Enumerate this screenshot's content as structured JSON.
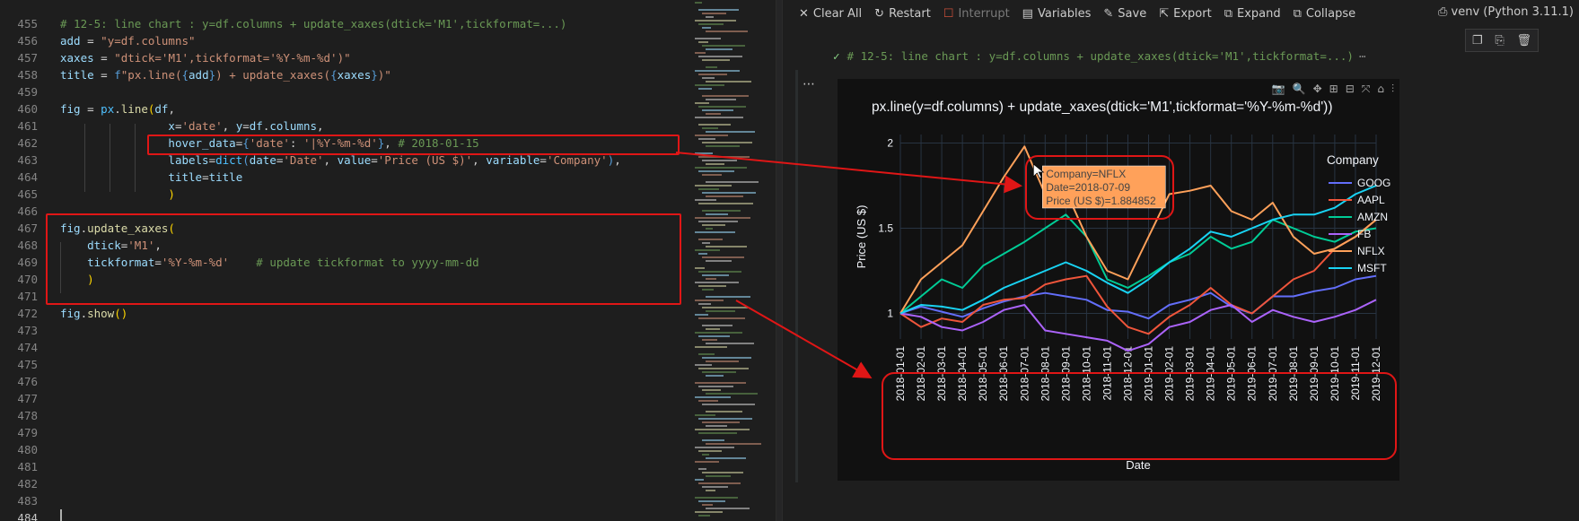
{
  "editor": {
    "line_numbers": [
      "455",
      "456",
      "457",
      "458",
      "459",
      "460",
      "461",
      "462",
      "463",
      "464",
      "465",
      "466",
      "467",
      "468",
      "469",
      "470",
      "471",
      "472",
      "473",
      "474",
      "475",
      "476",
      "477",
      "478",
      "479",
      "480",
      "481",
      "482",
      "483",
      "484"
    ]
  },
  "notebook": {
    "toolbar": {
      "clear_all": "Clear All",
      "restart": "Restart",
      "interrupt": "Interrupt",
      "variables": "Variables",
      "save": "Save",
      "export": "Export",
      "expand": "Expand",
      "collapse": "Collapse"
    },
    "kernel": "venv (Python 3.11.1)",
    "cell_header": "# 12-5: line chart : y=df.columns + update_xaxes(dtick='M1',tickformat=...)",
    "more": "⋯"
  },
  "chart_data": {
    "type": "line",
    "title": "px.line(y=df.columns) + update_xaxes(dtick='M1',tickformat='%Y-%m-%d'))",
    "xlabel": "Date",
    "ylabel": "Price (US $)",
    "ylim": [
      0.85,
      2.05
    ],
    "yticks": [
      "1",
      "1.5",
      "2"
    ],
    "ytick_values": [
      1,
      1.5,
      2
    ],
    "x_ticks": [
      "2018-01-01",
      "2018-02-01",
      "2018-03-01",
      "2018-04-01",
      "2018-05-01",
      "2018-06-01",
      "2018-07-01",
      "2018-08-01",
      "2018-09-01",
      "2018-10-01",
      "2018-11-01",
      "2018-12-01",
      "2019-01-01",
      "2019-02-01",
      "2019-03-01",
      "2019-04-01",
      "2019-05-01",
      "2019-06-01",
      "2019-07-01",
      "2019-08-01",
      "2019-09-01",
      "2019-10-01",
      "2019-11-01",
      "2019-12-01"
    ],
    "legend_title": "Company",
    "legend_position": "right",
    "grid": true,
    "series": [
      {
        "name": "GOOG",
        "color": "#636efa",
        "values": [
          1.0,
          1.04,
          1.01,
          0.98,
          1.03,
          1.07,
          1.1,
          1.12,
          1.1,
          1.08,
          1.02,
          1.01,
          0.97,
          1.05,
          1.08,
          1.12,
          1.04,
          1.0,
          1.1,
          1.1,
          1.13,
          1.15,
          1.2,
          1.22
        ]
      },
      {
        "name": "AAPL",
        "color": "#ef553b",
        "values": [
          1.0,
          0.92,
          0.97,
          0.95,
          1.05,
          1.08,
          1.09,
          1.17,
          1.2,
          1.22,
          1.04,
          0.92,
          0.88,
          0.98,
          1.05,
          1.15,
          1.05,
          1.0,
          1.1,
          1.2,
          1.25,
          1.38,
          1.45,
          1.55
        ]
      },
      {
        "name": "AMZN",
        "color": "#00cc96",
        "values": [
          1.0,
          1.1,
          1.2,
          1.15,
          1.28,
          1.35,
          1.42,
          1.5,
          1.58,
          1.45,
          1.2,
          1.15,
          1.22,
          1.3,
          1.35,
          1.45,
          1.38,
          1.42,
          1.55,
          1.5,
          1.45,
          1.42,
          1.48,
          1.5
        ]
      },
      {
        "name": "FB",
        "color": "#ab63fa",
        "values": [
          1.0,
          0.98,
          0.92,
          0.9,
          0.95,
          1.02,
          1.05,
          0.9,
          0.88,
          0.86,
          0.84,
          0.78,
          0.82,
          0.92,
          0.95,
          1.02,
          1.05,
          0.95,
          1.02,
          0.98,
          0.95,
          0.98,
          1.02,
          1.08
        ]
      },
      {
        "name": "NFLX",
        "color": "#ffa15a",
        "values": [
          1.0,
          1.2,
          1.3,
          1.4,
          1.6,
          1.8,
          1.98,
          1.7,
          1.72,
          1.45,
          1.25,
          1.2,
          1.45,
          1.7,
          1.72,
          1.75,
          1.6,
          1.55,
          1.65,
          1.45,
          1.35,
          1.38,
          1.45,
          1.55
        ]
      },
      {
        "name": "MSFT",
        "color": "#19d3f3",
        "values": [
          1.0,
          1.05,
          1.04,
          1.02,
          1.08,
          1.15,
          1.2,
          1.25,
          1.3,
          1.25,
          1.18,
          1.12,
          1.2,
          1.3,
          1.38,
          1.48,
          1.45,
          1.5,
          1.55,
          1.58,
          1.58,
          1.62,
          1.7,
          1.75
        ]
      }
    ],
    "hover": {
      "lines": [
        "Company=NFLX",
        "Date=2018-07-09",
        "Price (US $)=1.884852"
      ],
      "color": "#ffa15a"
    }
  }
}
